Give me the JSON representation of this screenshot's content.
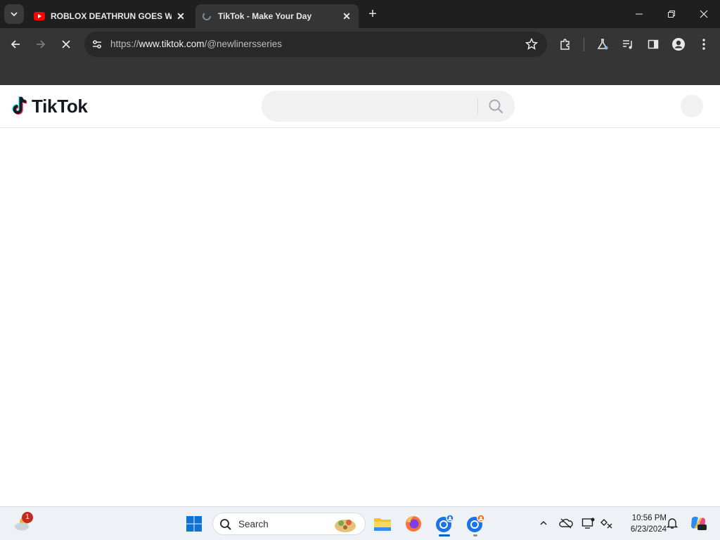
{
  "browser": {
    "tabs": [
      {
        "title": "ROBLOX DEATHRUN GOES WR",
        "favicon": "youtube-icon",
        "active": false
      },
      {
        "title": "TikTok - Make Your Day",
        "favicon": "tiktok-loading-icon",
        "active": true
      }
    ],
    "url": {
      "scheme": "https://",
      "host": "www.tiktok.com",
      "path": "/@newlinersseries"
    }
  },
  "tiktok": {
    "logo_text": "TikTok",
    "search_placeholder": "",
    "brand_colors": {
      "cyan": "#25f4ee",
      "red": "#fe2c55",
      "dark": "#161823"
    }
  },
  "taskbar": {
    "search_label": "Search",
    "weather_badge": "1",
    "time": "10:56 PM",
    "date": "6/23/2024"
  }
}
